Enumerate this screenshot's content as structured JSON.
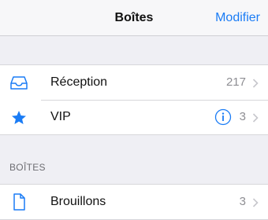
{
  "navbar": {
    "title": "Boîtes",
    "edit_label": "Modifier"
  },
  "mailboxes": [
    {
      "label": "Réception",
      "count": "217",
      "icon": "inbox-tray-icon"
    },
    {
      "label": "VIP",
      "count": "3",
      "icon": "star-icon",
      "has_info": true
    }
  ],
  "section": {
    "header": "BOÎTES",
    "items": [
      {
        "label": "Brouillons",
        "count": "3",
        "icon": "document-icon"
      }
    ]
  },
  "colors": {
    "accent": "#1a7cf5",
    "background": "#efeff4",
    "cell": "#ffffff",
    "secondary_text": "#8e8e93"
  }
}
